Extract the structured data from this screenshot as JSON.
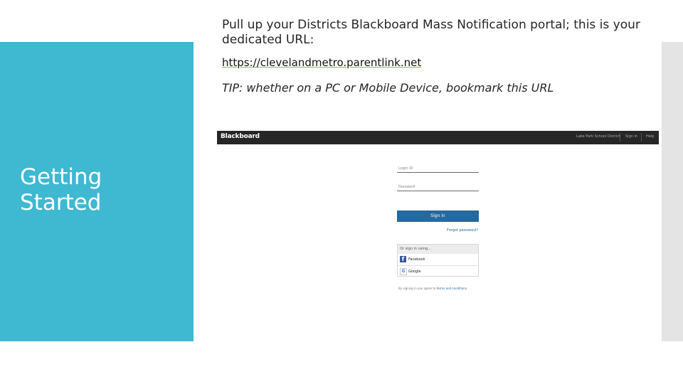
{
  "slide": {
    "title_line1": "Getting",
    "title_line2": "Started",
    "intro": "Pull up your Districts Blackboard Mass Notification portal;  this is your dedicated URL:",
    "url": "https://clevelandmetro.parentlink.net",
    "tip": "TIP:  whether on a PC or Mobile Device, bookmark this URL"
  },
  "blackboard": {
    "logo": "Blackboard",
    "nav_school": "Lake Park School District",
    "nav_signin": "Sign in",
    "nav_help": "Help",
    "login_placeholder": "Login ID",
    "password_placeholder": "Password",
    "signin_button": "Sign in",
    "forgot_password": "Forgot password?",
    "social_header": "Or sign in using...",
    "facebook": "Facebook",
    "google": "Google",
    "terms_prefix": "By signing in you agree to",
    "terms_link": "terms and conditions."
  },
  "colors": {
    "accent_panel": "#3fb8d2",
    "link_underline": "#8cbf3f",
    "bb_header": "#262626",
    "bb_button": "#256a9f"
  }
}
